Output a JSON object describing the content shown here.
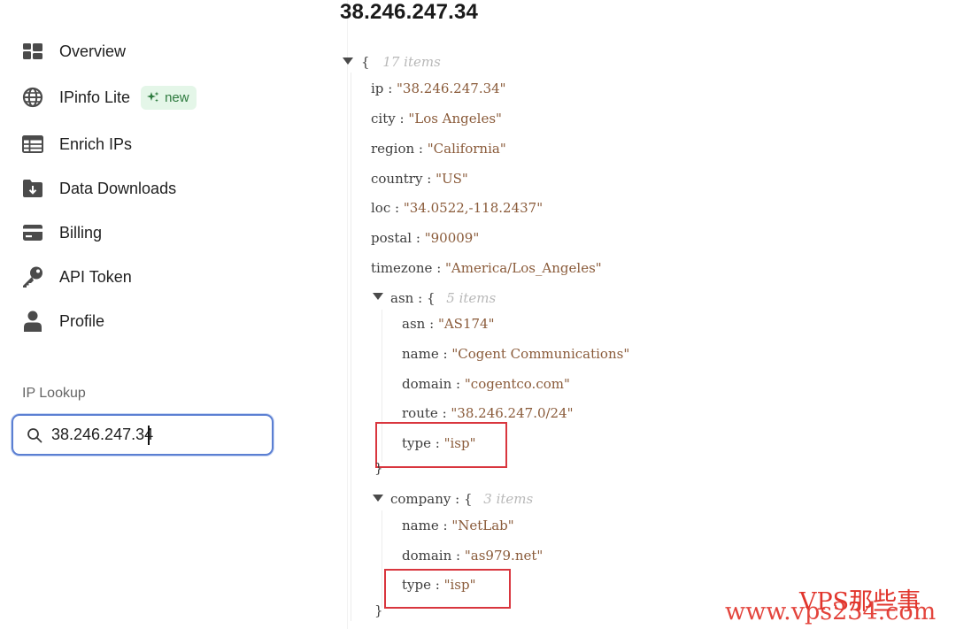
{
  "sidebar": {
    "items": [
      {
        "label": "Overview",
        "icon": "dashboard-icon"
      },
      {
        "label": "IPinfo Lite",
        "icon": "globe-icon",
        "badge": "new"
      },
      {
        "label": "Enrich IPs",
        "icon": "table-icon"
      },
      {
        "label": "Data Downloads",
        "icon": "folder-download-icon"
      },
      {
        "label": "Billing",
        "icon": "credit-card-icon"
      },
      {
        "label": "API Token",
        "icon": "key-icon"
      },
      {
        "label": "Profile",
        "icon": "user-icon"
      }
    ],
    "section_label": "IP Lookup",
    "search_value": "38.246.247.34"
  },
  "main": {
    "title": "38.246.247.34",
    "root_count": "17 items",
    "fields": [
      {
        "key": "ip",
        "value": "\"38.246.247.34\""
      },
      {
        "key": "city",
        "value": "\"Los Angeles\""
      },
      {
        "key": "region",
        "value": "\"California\""
      },
      {
        "key": "country",
        "value": "\"US\""
      },
      {
        "key": "loc",
        "value": "\"34.0522,-118.2437\""
      },
      {
        "key": "postal",
        "value": "\"90009\""
      },
      {
        "key": "timezone",
        "value": "\"America/Los_Angeles\""
      }
    ],
    "asn": {
      "key": "asn",
      "count": "5 items",
      "fields": [
        {
          "key": "asn",
          "value": "\"AS174\""
        },
        {
          "key": "name",
          "value": "\"Cogent Communications\""
        },
        {
          "key": "domain",
          "value": "\"cogentco.com\""
        },
        {
          "key": "route",
          "value": "\"38.246.247.0/24\""
        },
        {
          "key": "type",
          "value": "\"isp\""
        }
      ]
    },
    "company": {
      "key": "company",
      "count": "3 items",
      "fields": [
        {
          "key": "name",
          "value": "\"NetLab\""
        },
        {
          "key": "domain",
          "value": "\"as979.net\""
        },
        {
          "key": "type",
          "value": "\"isp\""
        }
      ]
    },
    "open_brace": "{",
    "close_brace": "}",
    "colon": ":"
  },
  "watermark": {
    "line1": "VPS那些事",
    "line2": "www.vps234.com"
  },
  "colors": {
    "accent": "#5b7fd2",
    "badge_bg": "#e4f6e8",
    "badge_text": "#2d7a3e",
    "json_string": "#8a5b3a",
    "highlight": "#d9363e",
    "watermark": "#e1352c"
  }
}
